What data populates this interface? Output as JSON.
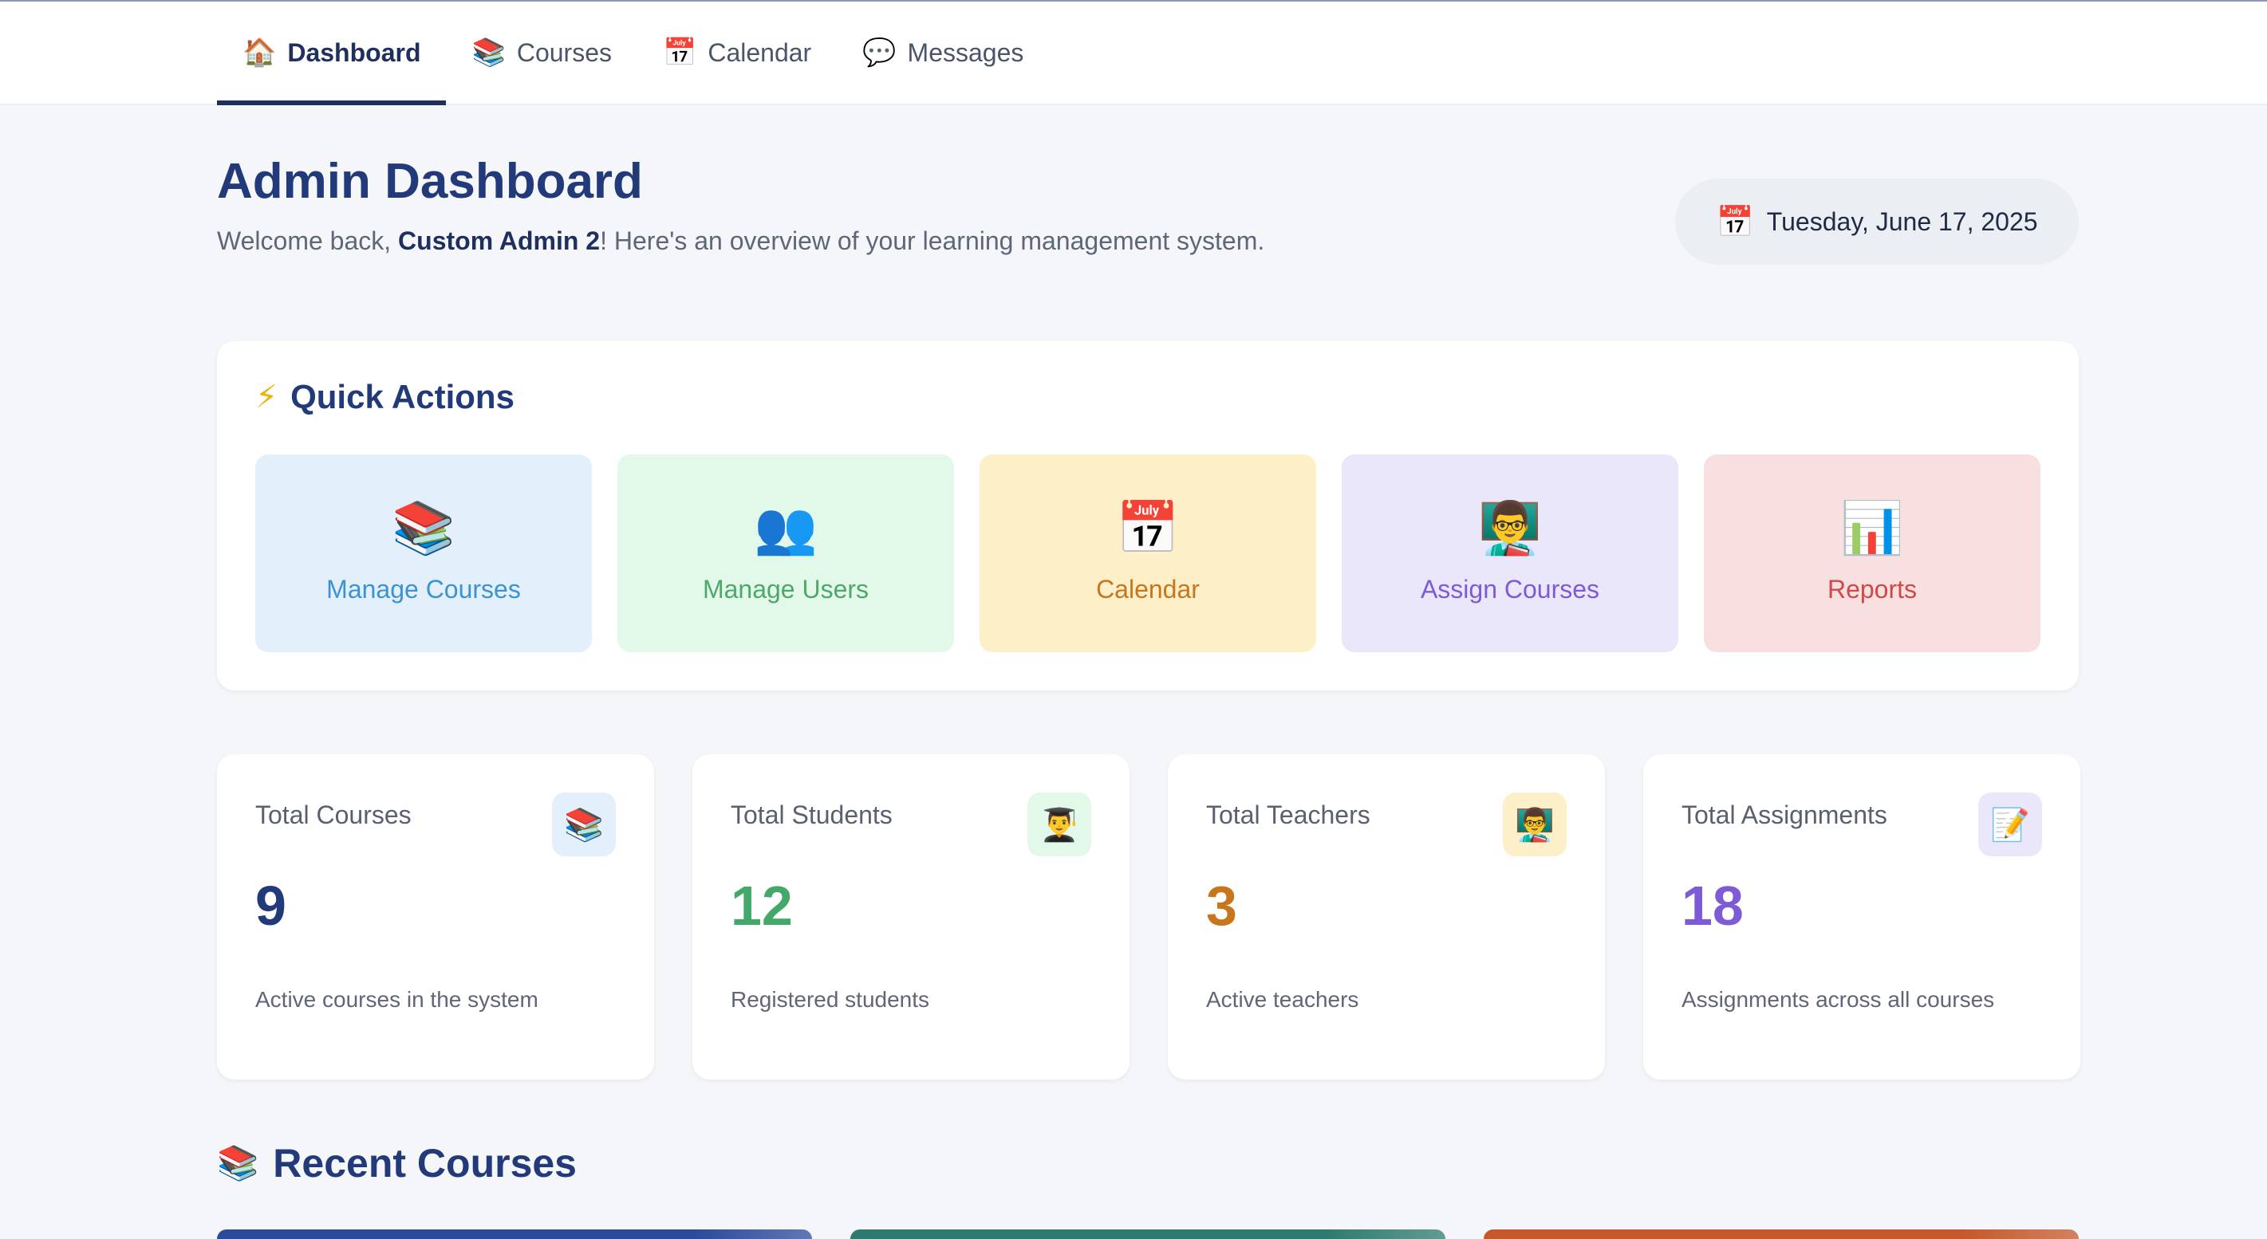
{
  "nav": {
    "tabs": [
      {
        "label": "Dashboard",
        "icon": "🏠"
      },
      {
        "label": "Courses",
        "icon": "📚"
      },
      {
        "label": "Calendar",
        "icon": "📅"
      },
      {
        "label": "Messages",
        "icon": "💬"
      }
    ],
    "active_tab": "Dashboard"
  },
  "header": {
    "title": "Admin Dashboard",
    "welcome_prefix": "Welcome back, ",
    "user_name": "Custom Admin 2",
    "welcome_suffix": "! Here's an overview of your learning management system.",
    "date_icon": "📅",
    "date": "Tuesday, June 17, 2025"
  },
  "quick_actions": {
    "icon": "⚡",
    "title": "Quick Actions",
    "items": [
      {
        "label": "Manage Courses",
        "icon": "📚",
        "bg": "#e3f0fc",
        "color": "#3d93d1"
      },
      {
        "label": "Manage Users",
        "icon": "👥",
        "bg": "#e2f8e8",
        "color": "#4fa86b"
      },
      {
        "label": "Calendar",
        "icon": "📅",
        "bg": "#fdf0c8",
        "color": "#c8761c"
      },
      {
        "label": "Assign Courses",
        "icon": "👨‍🏫",
        "bg": "#ebe7fb",
        "color": "#7e5bd6"
      },
      {
        "label": "Reports",
        "icon": "📊",
        "bg": "#f8e0e0",
        "color": "#d04848"
      }
    ]
  },
  "stats": [
    {
      "label": "Total Courses",
      "value": "9",
      "desc": "Active courses in the system",
      "icon": "📚",
      "icon_bg": "#e3f0fc",
      "value_color": "#233a7a"
    },
    {
      "label": "Total Students",
      "value": "12",
      "desc": "Registered students",
      "icon": "👨‍🎓",
      "icon_bg": "#e2f8e8",
      "value_color": "#45a86b"
    },
    {
      "label": "Total Teachers",
      "value": "3",
      "desc": "Active teachers",
      "icon": "👨‍🏫",
      "icon_bg": "#fdf0c8",
      "value_color": "#c8761c"
    },
    {
      "label": "Total Assignments",
      "value": "18",
      "desc": "Assignments across all courses",
      "icon": "📝",
      "icon_bg": "#ebe7fb",
      "value_color": "#7e5bd6"
    }
  ],
  "recent_courses": {
    "icon": "📚",
    "title": "Recent Courses",
    "card_colors": [
      "#2b4a9a",
      "#2f7a6e",
      "#c4582a"
    ]
  }
}
